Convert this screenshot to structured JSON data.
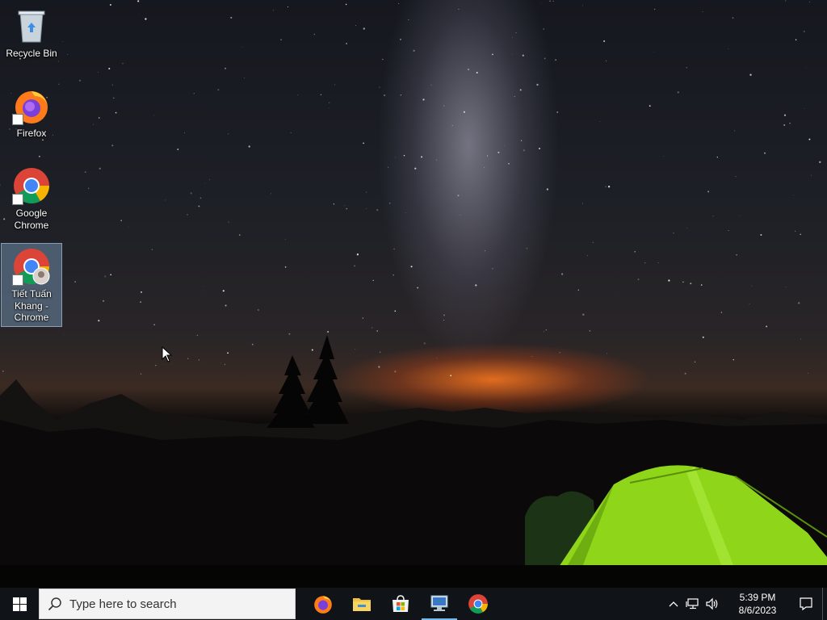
{
  "desktop": {
    "icons": [
      {
        "label": "Recycle Bin",
        "icon": "recycle-bin-icon"
      },
      {
        "label": "Firefox",
        "icon": "firefox-icon"
      },
      {
        "label": "Google Chrome",
        "icon": "chrome-icon"
      },
      {
        "label": "Tiết Tuấn Khang - Chrome",
        "icon": "chrome-profile-icon"
      }
    ]
  },
  "taskbar": {
    "search_placeholder": "Type here to search",
    "apps": [
      {
        "name": "Firefox",
        "icon": "firefox-icon"
      },
      {
        "name": "File Explorer",
        "icon": "folder-icon"
      },
      {
        "name": "Microsoft Store",
        "icon": "store-icon"
      },
      {
        "name": "Remote Desktop",
        "icon": "remote-desktop-icon"
      },
      {
        "name": "Google Chrome",
        "icon": "chrome-icon"
      }
    ],
    "clock": {
      "time": "5:39 PM",
      "date": "8/6/2023"
    }
  },
  "colors": {
    "taskbar_bg": "#101418",
    "active_indicator": "#76b9ed",
    "tent_green": "#8fd61a"
  }
}
